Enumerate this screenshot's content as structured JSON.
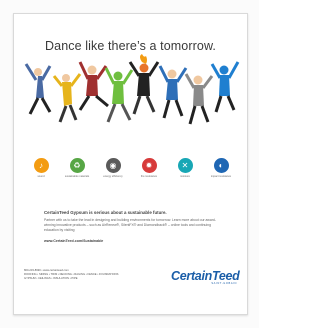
{
  "ad": {
    "headline": "Dance like there’s a tomorrow."
  },
  "icons": [
    {
      "name": "sound-icon",
      "label": "sound",
      "color": "#f39c12",
      "glyph": "♪"
    },
    {
      "name": "recycle-icon",
      "label": "sustainable materials",
      "color": "#57a645",
      "glyph": "♻"
    },
    {
      "name": "energy-icon",
      "label": "energy efficiency",
      "color": "#5a5a5a",
      "glyph": "◉"
    },
    {
      "name": "fire-icon",
      "label": "fire resistance",
      "color": "#d73b3b",
      "glyph": "✹"
    },
    {
      "name": "moisture-icon",
      "label": "moisture",
      "color": "#18a7b5",
      "glyph": "✕"
    },
    {
      "name": "impact-icon",
      "label": "impact resistance",
      "color": "#1f67b4",
      "glyph": "◐"
    }
  ],
  "body": {
    "title": "CertainTeed Gypsum is serious about a sustainable future.",
    "text": "Partner with us to take the lead in designing and building environments for tomorrow. Learn more about our award-winning innovative products – such as AirRenew®, SilentFX® and Diamondback® – online tools and continuing education by visiting",
    "url": "www.CertainTeed.com/Sustainable"
  },
  "footer": {
    "contact": "800-233-8990 • www.certainteed.com",
    "line1": "ROOFING • SIDING • TRIM • DECKING • RAILING • FENCE • FOUNDATIONS",
    "line2": "GYPSUM • CEILINGS • INSULATION • PIPE"
  },
  "logo": {
    "word": "CertainTeed",
    "sub": "SAINT-GOBAIN",
    "color": "#1b5ea8"
  }
}
